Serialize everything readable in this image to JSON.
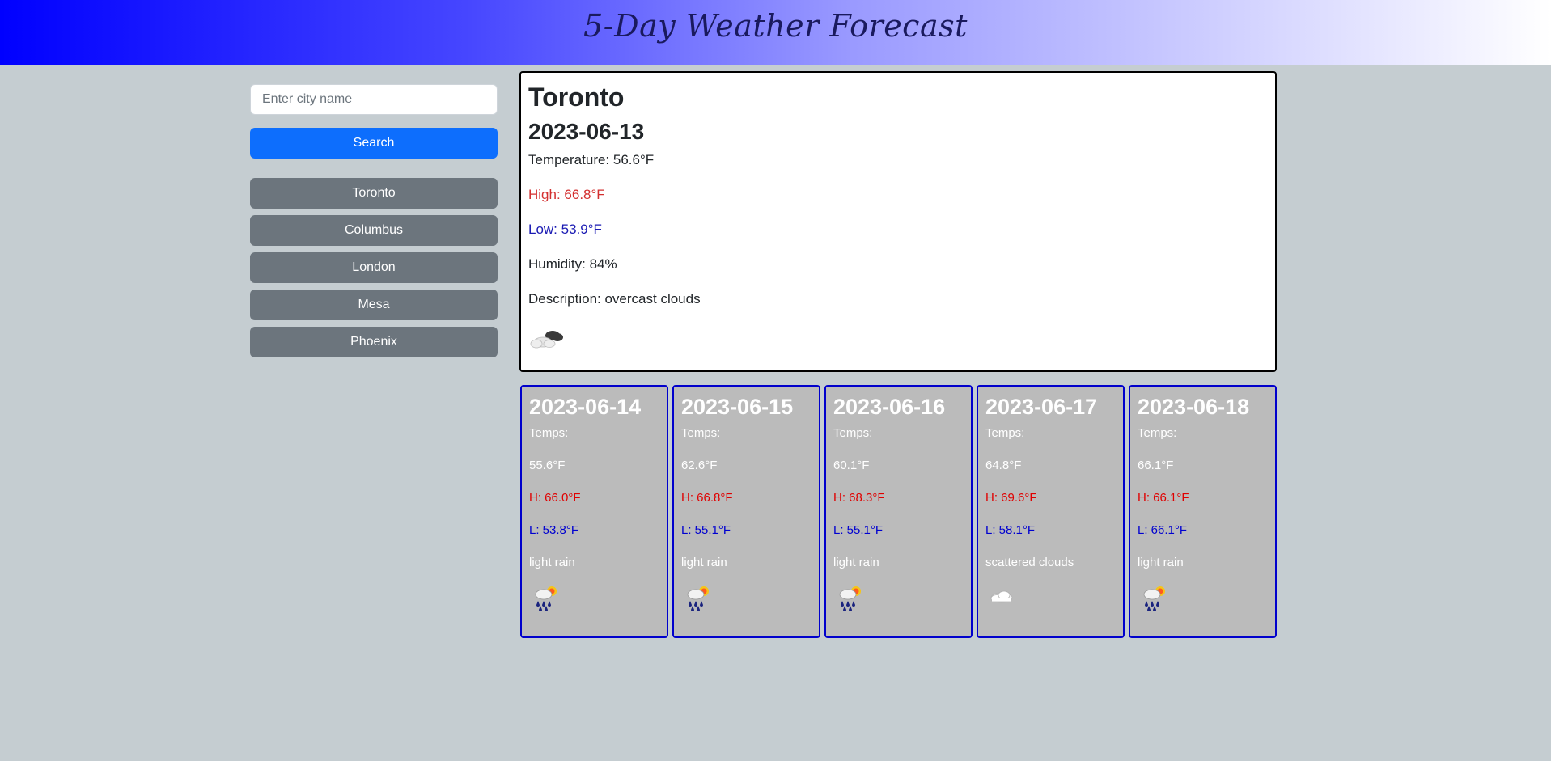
{
  "header": {
    "title": "5-Day Weather Forecast"
  },
  "search": {
    "placeholder": "Enter city name",
    "button_label": "Search"
  },
  "history": [
    "Toronto",
    "Columbus",
    "London",
    "Mesa",
    "Phoenix"
  ],
  "current": {
    "city": "Toronto",
    "date": "2023-06-13",
    "temperature": "Temperature: 56.6°F",
    "high": "High: 66.8°F",
    "low": "Low: 53.9°F",
    "humidity": "Humidity: 84%",
    "description": "Description: overcast clouds",
    "icon": "overcast-clouds-icon"
  },
  "forecast": [
    {
      "date": "2023-06-14",
      "temps_label": "Temps:",
      "temp": "55.6°F",
      "high": "H: 66.0°F",
      "low": "L: 53.8°F",
      "description": "light rain",
      "icon": "light-rain-icon"
    },
    {
      "date": "2023-06-15",
      "temps_label": "Temps:",
      "temp": "62.6°F",
      "high": "H: 66.8°F",
      "low": "L: 55.1°F",
      "description": "light rain",
      "icon": "light-rain-icon"
    },
    {
      "date": "2023-06-16",
      "temps_label": "Temps:",
      "temp": "60.1°F",
      "high": "H: 68.3°F",
      "low": "L: 55.1°F",
      "description": "light rain",
      "icon": "light-rain-icon"
    },
    {
      "date": "2023-06-17",
      "temps_label": "Temps:",
      "temp": "64.8°F",
      "high": "H: 69.6°F",
      "low": "L: 58.1°F",
      "description": "scattered clouds",
      "icon": "scattered-clouds-icon"
    },
    {
      "date": "2023-06-18",
      "temps_label": "Temps:",
      "temp": "66.1°F",
      "high": "H: 66.1°F",
      "low": "L: 66.1°F",
      "description": "light rain",
      "icon": "light-rain-icon"
    }
  ],
  "colors": {
    "header_start": "#0000ff",
    "search_button": "#0d6efd",
    "history_button": "#6c757d",
    "card_border": "#0000cc",
    "card_bg": "#bbbbbb",
    "high_text": "#e00000",
    "low_text": "#0000d0"
  }
}
